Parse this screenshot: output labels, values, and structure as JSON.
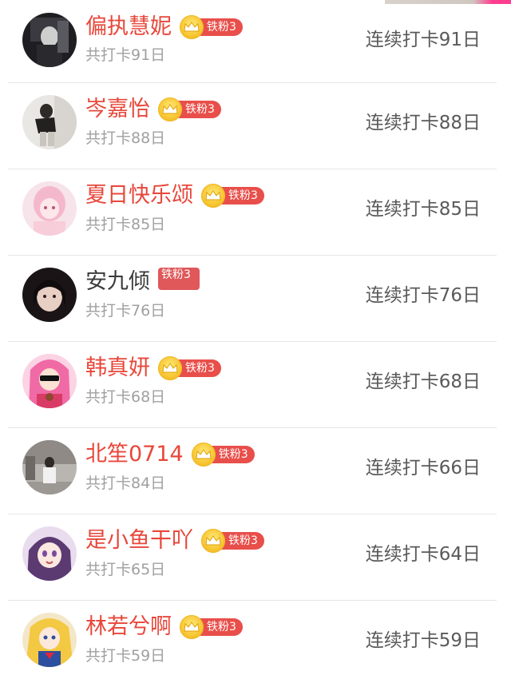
{
  "list": {
    "rows": [
      {
        "name": "偏执慧妮",
        "badge": "铁粉3",
        "total": "共打卡91日",
        "streak": "连续打卡91日",
        "avatar": "dark-room"
      },
      {
        "name": "岑嘉怡",
        "badge": "铁粉3",
        "total": "共打卡88日",
        "streak": "连续打卡88日",
        "avatar": "girl-white-wall"
      },
      {
        "name": "夏日快乐颂",
        "badge": "铁粉3",
        "total": "共打卡85日",
        "streak": "连续打卡85日",
        "avatar": "anime-pink"
      },
      {
        "name": "安九倾",
        "badge": "铁粉3",
        "total": "共打卡76日",
        "streak": "连续打卡76日",
        "avatar": "selfie-dark"
      },
      {
        "name": "韩真妍",
        "badge": "铁粉3",
        "total": "共打卡68日",
        "streak": "连续打卡68日",
        "avatar": "cartoon-sunglasses"
      },
      {
        "name": "北笙0714",
        "badge": "铁粉3",
        "total": "共打卡84日",
        "streak": "连续打卡66日",
        "avatar": "street-photo"
      },
      {
        "name": "是小鱼干吖",
        "badge": "铁粉3",
        "total": "共打卡65日",
        "streak": "连续打卡64日",
        "avatar": "anime-purple"
      },
      {
        "name": "林若兮啊",
        "badge": "铁粉3",
        "total": "共打卡59日",
        "streak": "连续打卡59日",
        "avatar": "sailor-moon"
      }
    ]
  },
  "colors": {
    "name": "#e8473a",
    "badge": "#e84f4a",
    "crown": "#f7c531",
    "streak": "#5a5a5a",
    "total": "#a0a0a0"
  }
}
